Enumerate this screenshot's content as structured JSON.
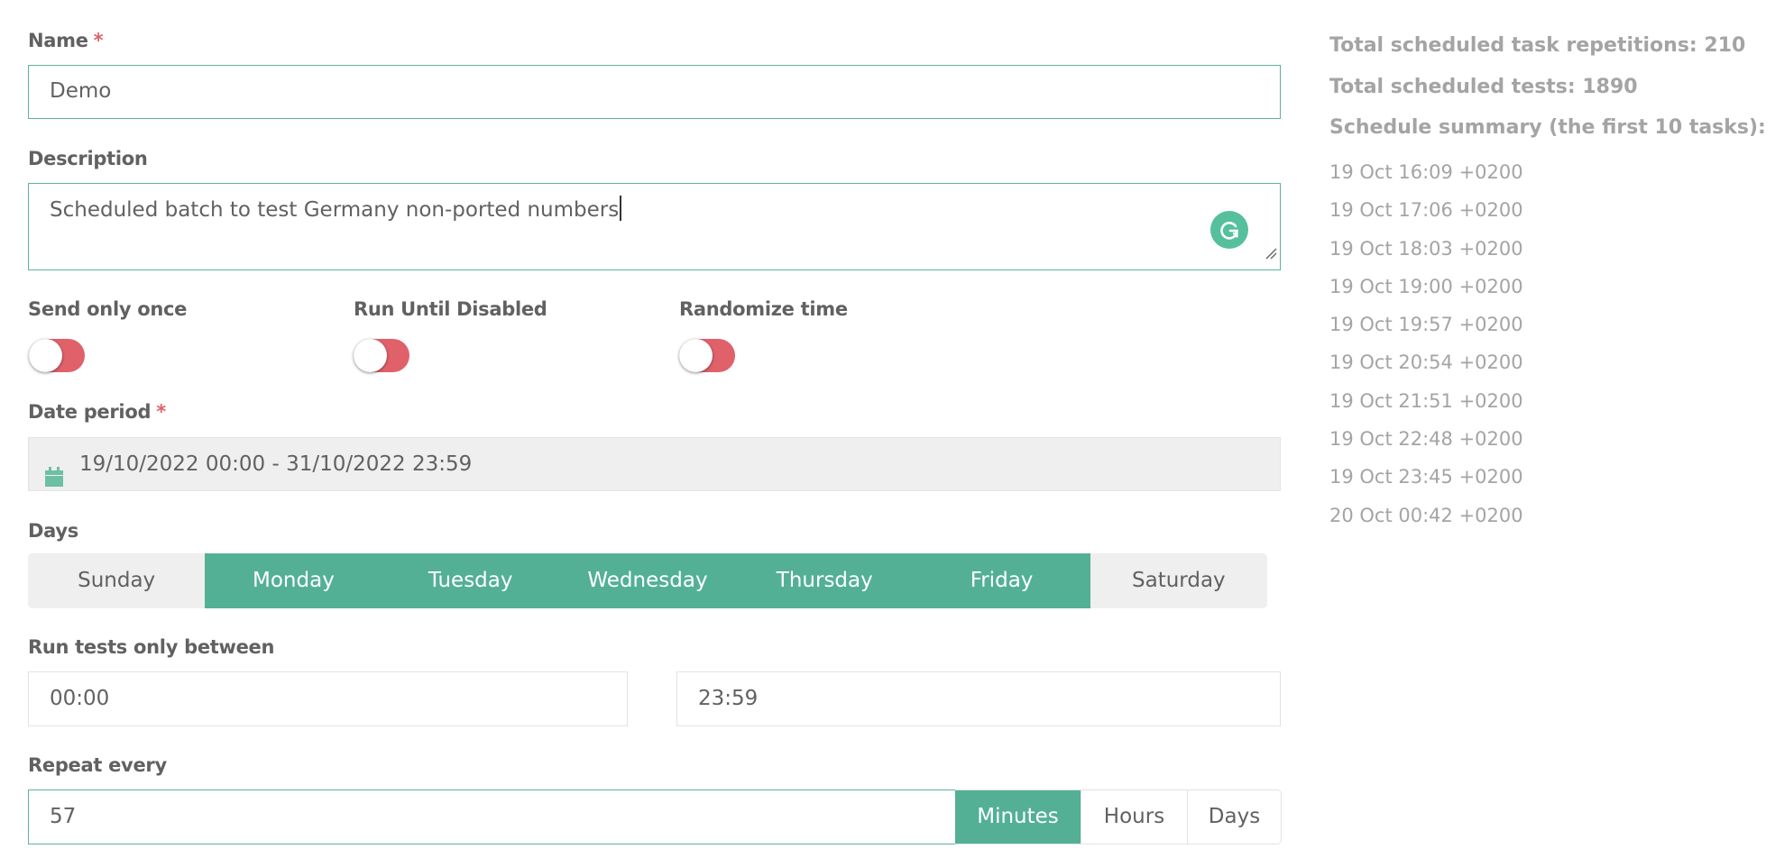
{
  "form": {
    "name": {
      "label": "Name",
      "required_mark": "*",
      "value": "Demo"
    },
    "description": {
      "label": "Description",
      "value": "Scheduled batch to test Germany non-ported numbers"
    },
    "toggles": [
      {
        "label": "Send only once",
        "on": false
      },
      {
        "label": "Run Until Disabled",
        "on": false
      },
      {
        "label": "Randomize time",
        "on": false
      }
    ],
    "date_period": {
      "label": "Date period",
      "required_mark": "*",
      "icon": "calendar-icon",
      "value": "19/10/2022 00:00 - 31/10/2022 23:59"
    },
    "days": {
      "label": "Days",
      "items": [
        {
          "label": "Sunday",
          "selected": false
        },
        {
          "label": "Monday",
          "selected": true
        },
        {
          "label": "Tuesday",
          "selected": true
        },
        {
          "label": "Wednesday",
          "selected": true
        },
        {
          "label": "Thursday",
          "selected": true
        },
        {
          "label": "Friday",
          "selected": true
        },
        {
          "label": "Saturday",
          "selected": false
        }
      ]
    },
    "run_between": {
      "label": "Run tests only between",
      "start": "00:00",
      "end": "23:59"
    },
    "repeat_every": {
      "label": "Repeat every",
      "value": "57",
      "units": [
        {
          "label": "Minutes",
          "selected": true
        },
        {
          "label": "Hours",
          "selected": false
        },
        {
          "label": "Days",
          "selected": false
        }
      ]
    }
  },
  "summary": {
    "total_repetitions": "Total scheduled task repetitions: 210",
    "total_tests": "Total scheduled tests: 1890",
    "summary_title": "Schedule summary (the first 10 tasks):",
    "tasks": [
      "19 Oct 16:09 +0200",
      "19 Oct 17:06 +0200",
      "19 Oct 18:03 +0200",
      "19 Oct 19:00 +0200",
      "19 Oct 19:57 +0200",
      "19 Oct 20:54 +0200",
      "19 Oct 21:51 +0200",
      "19 Oct 22:48 +0200",
      "19 Oct 23:45 +0200",
      "20 Oct 00:42 +0200"
    ]
  },
  "colors": {
    "accent": "#53b095",
    "toggle_off": "#e0616a",
    "required": "#e0616a",
    "muted_text": "#a4a4a4"
  }
}
